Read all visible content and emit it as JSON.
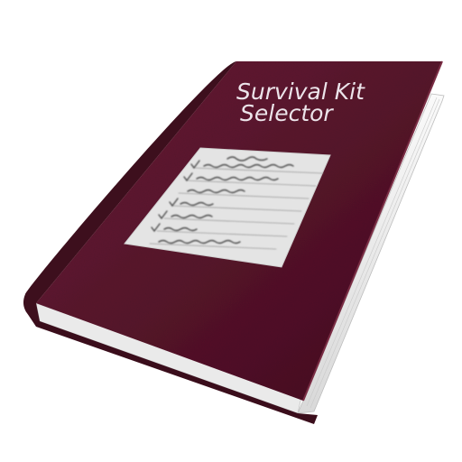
{
  "book": {
    "title_line1": "Survival Kit",
    "title_line2": "Selector",
    "cover_color": "#5a1a2e",
    "spine_color": "#3d0f1d",
    "pages_color": "#f1f1f1"
  },
  "label": {
    "icon": "checklist-icon",
    "background": "#e3e3e3"
  }
}
